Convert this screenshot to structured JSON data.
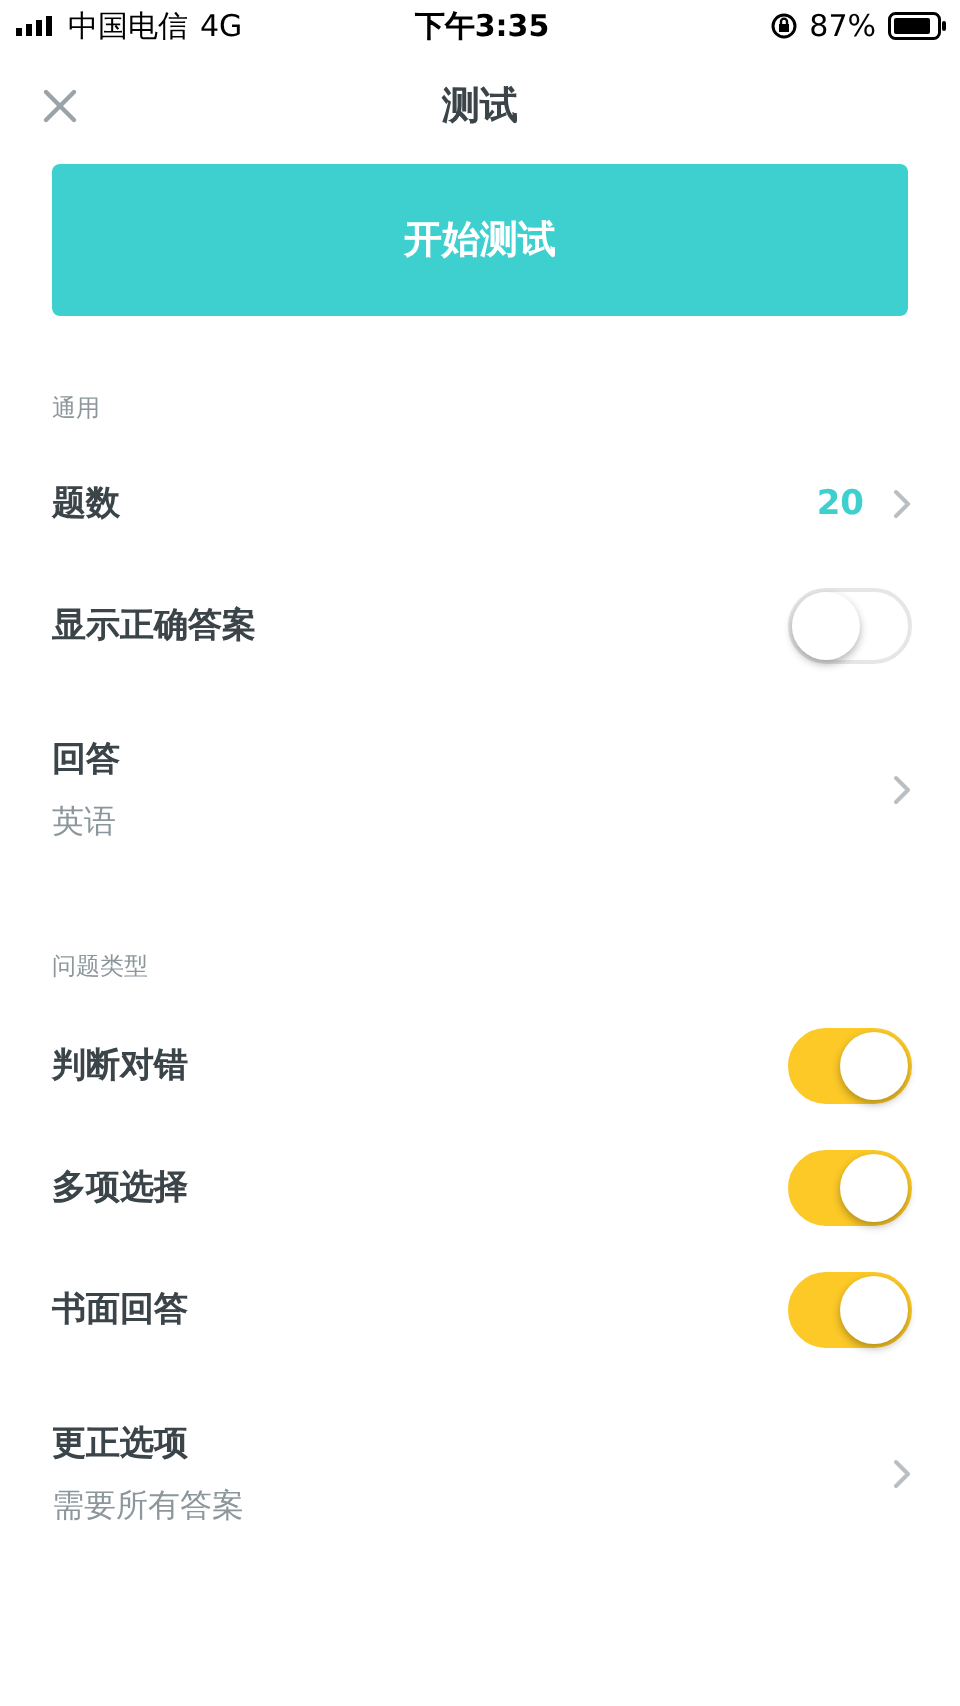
{
  "status_bar": {
    "carrier": "中国电信",
    "network": "4G",
    "time": "下午3:35",
    "battery_percent": "87%"
  },
  "header": {
    "title": "测试"
  },
  "start_button": {
    "label": "开始测试"
  },
  "sections": [
    {
      "title": "通用",
      "items": [
        {
          "kind": "value",
          "label": "题数",
          "value": "20"
        },
        {
          "kind": "toggle",
          "label": "显示正确答案",
          "on": false
        },
        {
          "kind": "detail",
          "label": "回答",
          "subtitle": "英语"
        }
      ]
    },
    {
      "title": "问题类型",
      "items": [
        {
          "kind": "toggle",
          "label": "判断对错",
          "on": true
        },
        {
          "kind": "toggle",
          "label": "多项选择",
          "on": true
        },
        {
          "kind": "toggle",
          "label": "书面回答",
          "on": true
        },
        {
          "kind": "detail",
          "label": "更正选项",
          "subtitle": "需要所有答案"
        }
      ]
    }
  ]
}
